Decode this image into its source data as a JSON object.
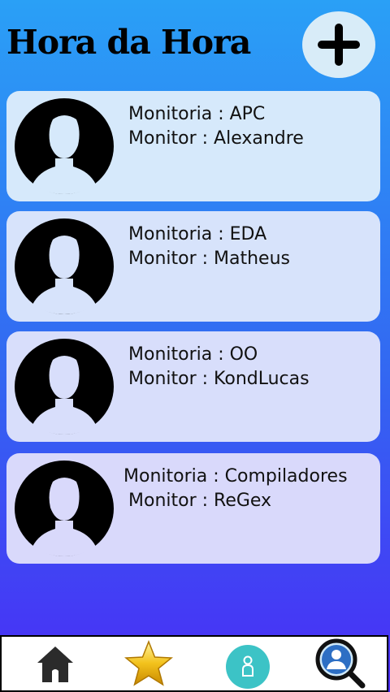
{
  "app": {
    "title": "Hora da Hora",
    "accent": "#3366f2"
  },
  "header": {
    "add_icon": "plus-icon"
  },
  "cards": [
    {
      "subject": "Monitoria : APC",
      "monitor": "Monitor : Alexandre",
      "icon": "user-avatar-icon"
    },
    {
      "subject": "Monitoria : EDA",
      "monitor": "Monitor : Matheus",
      "icon": "user-avatar-icon"
    },
    {
      "subject": "Monitoria : OO",
      "monitor": "Monitor : KondLucas",
      "icon": "user-avatar-icon"
    },
    {
      "subject": "Monitoria : Compiladores",
      "monitor": "Monitor : ReGex",
      "icon": "user-avatar-icon"
    }
  ],
  "bottom_nav": {
    "items": [
      {
        "icon": "home-icon"
      },
      {
        "icon": "star-icon"
      },
      {
        "icon": "profile-icon"
      },
      {
        "icon": "search-user-icon"
      }
    ]
  }
}
